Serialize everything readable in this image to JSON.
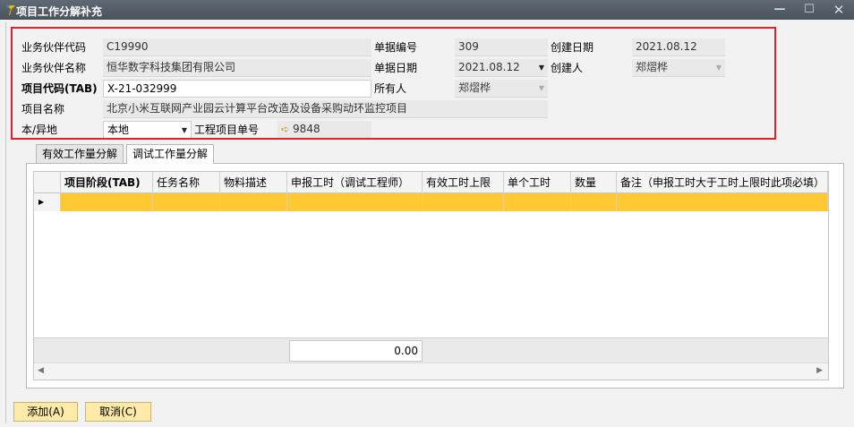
{
  "window": {
    "title": "项目工作分解补充",
    "minimize_label": "—",
    "maximize_label": "☐",
    "close_label": "✕"
  },
  "header": {
    "partner_code_label": "业务伙伴代码",
    "partner_code": "C19990",
    "partner_name_label": "业务伙伴名称",
    "partner_name": "恒华数字科技集团有限公司",
    "project_code_label": "项目代码(TAB)",
    "project_code": "X-21-032999",
    "project_name_label": "项目名称",
    "project_name": "北京小米互联网产业园云计算平台改造及设备采购动环监控项目",
    "location_label": "本/异地",
    "location": "本地",
    "doc_no_label": "单据编号",
    "doc_no": "309",
    "doc_date_label": "单据日期",
    "doc_date": "2021.08.12",
    "owner_label": "所有人",
    "owner": "郑熠桦",
    "eng_project_no_label": "工程项目单号",
    "eng_project_no": "9848",
    "created_date_label": "创建日期",
    "created_date": "2021.08.12",
    "creator_label": "创建人",
    "creator": "郑熠桦"
  },
  "tabs": [
    {
      "label": "有效工作量分解"
    },
    {
      "label": "调试工作量分解"
    }
  ],
  "grid": {
    "columns": [
      "项目阶段(TAB)",
      "任务名称",
      "物料描述",
      "申报工时（调试工程师）",
      "有效工时上限",
      "单个工时",
      "数量",
      "备注（申报工时大于工时上限时此项必填）"
    ],
    "total": "0.00"
  },
  "buttons": {
    "add": "添加(A)",
    "cancel": "取消(C)"
  },
  "colors": {
    "highlight_border": "#e0202a",
    "selected_row": "#ffc933",
    "button_bg": "#fde9a8"
  }
}
